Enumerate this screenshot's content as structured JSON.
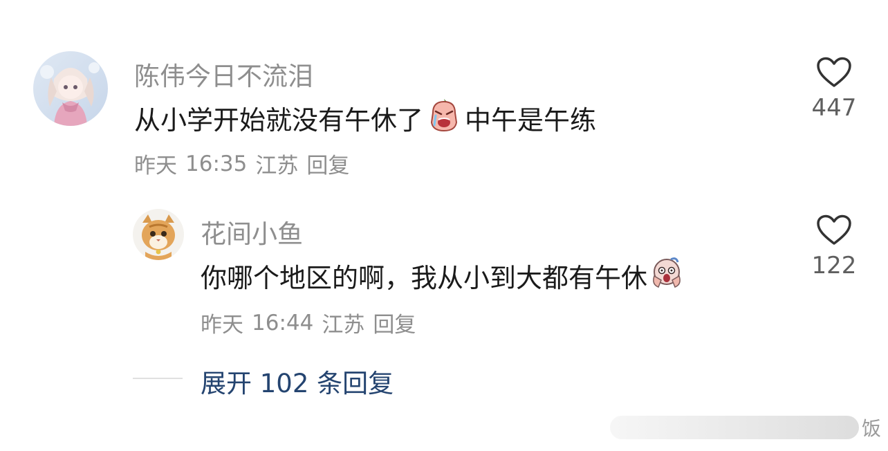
{
  "comments": [
    {
      "username": "陈伟今日不流泪",
      "text_before": "从小学开始就没有午休了",
      "emoji": "crying-emoji",
      "text_after": "中午是午练",
      "date": "昨天",
      "time": "16:35",
      "location": "江苏",
      "reply_label": "回复",
      "likes": "447"
    },
    {
      "username": "花间小鱼",
      "text_before": "你哪个地区的啊，我从小到大都有午休",
      "emoji": "shocked-emoji",
      "text_after": "",
      "date": "昨天",
      "time": "16:44",
      "location": "江苏",
      "reply_label": "回复",
      "likes": "122"
    }
  ],
  "expand_replies": "展开 102 条回复",
  "watermark": {
    "text": "饭"
  },
  "colors": {
    "username": "#8e8e8e",
    "content": "#1a1a1a",
    "meta": "#8e8e8e",
    "like_count": "#5f5f5f",
    "expand_link": "#244470"
  }
}
